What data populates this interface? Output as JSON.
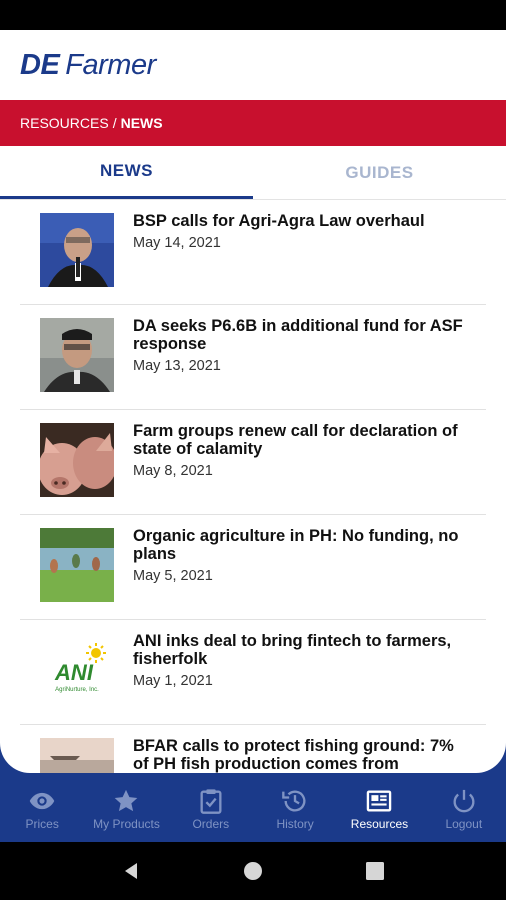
{
  "app": {
    "logo_de": "DE",
    "logo_farmer": "Farmer"
  },
  "breadcrumb": {
    "section": "RESOURCES",
    "separator": "/",
    "current": "NEWS"
  },
  "tabs": [
    {
      "label": "NEWS",
      "active": true
    },
    {
      "label": "GUIDES",
      "active": false
    }
  ],
  "news": [
    {
      "title": "BSP calls for Agri-Agra Law overhaul",
      "date": "May 14, 2021"
    },
    {
      "title": "DA seeks P6.6B in additional fund for ASF response",
      "date": "May 13, 2021"
    },
    {
      "title": "Farm groups renew call for declaration of state of calamity",
      "date": "May 8, 2021"
    },
    {
      "title": "Organic agriculture in PH: No funding, no plans",
      "date": "May 5, 2021"
    },
    {
      "title": "ANI inks deal to bring fintech to farmers, fisherfolk",
      "date": "May 1, 2021"
    },
    {
      "title": "BFAR calls to protect fishing ground: 7% of PH fish production comes from",
      "date": ""
    }
  ],
  "thumb_texts": {
    "ani_logo": "ANI",
    "ani_sub": "AgriNurture, Inc."
  },
  "bottom_nav": [
    {
      "label": "Prices",
      "icon": "eye-icon",
      "active": false
    },
    {
      "label": "My Products",
      "icon": "star-icon",
      "active": false
    },
    {
      "label": "Orders",
      "icon": "clipboard-check-icon",
      "active": false
    },
    {
      "label": "History",
      "icon": "history-icon",
      "active": false
    },
    {
      "label": "Resources",
      "icon": "newspaper-icon",
      "active": true
    },
    {
      "label": "Logout",
      "icon": "power-icon",
      "active": false
    }
  ],
  "colors": {
    "brand_blue": "#1b3a8a",
    "brand_red": "#c8102e",
    "inactive_tab": "#a9b6cf",
    "nav_inactive": "#7f93c4"
  }
}
